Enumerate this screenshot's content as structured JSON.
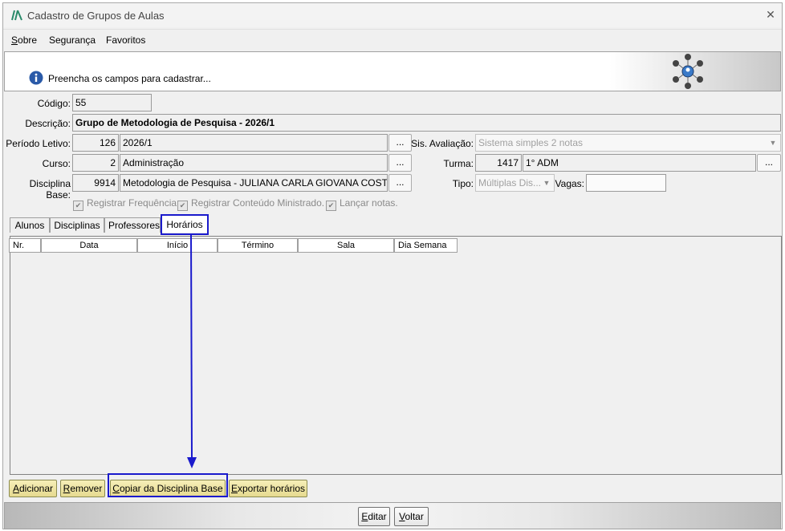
{
  "window": {
    "title": "Cadastro de Grupos de Aulas",
    "close_label": "✕"
  },
  "menu": {
    "items": [
      "Sobre",
      "Segurança",
      "Favoritos"
    ]
  },
  "banner": {
    "message": "Preencha os campos para cadastrar..."
  },
  "form": {
    "codigo": {
      "label": "Código:",
      "value": "55"
    },
    "descricao": {
      "label": "Descrição:",
      "value": "Grupo de Metodologia de Pesquisa - 2026/1"
    },
    "periodo": {
      "label": "Período Letivo:",
      "code": "126",
      "value": "2026/1"
    },
    "curso": {
      "label": "Curso:",
      "code": "2",
      "value": "Administração"
    },
    "disciplina": {
      "label": "Disciplina Base:",
      "code": "9914",
      "value": "Metodologia de Pesquisa - JULIANA CARLA GIOVANA COSTA"
    },
    "sis_avaliacao": {
      "label": "Sis. Avaliação:",
      "value": "Sistema simples 2 notas"
    },
    "turma": {
      "label": "Turma:",
      "code": "1417",
      "value": "1° ADM"
    },
    "tipo": {
      "label": "Tipo:",
      "value": "Múltiplas Dis..."
    },
    "vagas": {
      "label": "Vagas:",
      "value": ""
    },
    "dots_label": "...",
    "checks": [
      "Registrar Frequência.",
      "Registrar Conteúdo Ministrado.",
      "Lançar notas."
    ]
  },
  "tabs": [
    "Alunos",
    "Disciplinas",
    "Professores",
    "Horários"
  ],
  "active_tab": "Horários",
  "grid": {
    "columns": [
      "Nr.",
      "Data",
      "Início",
      "Término",
      "Sala",
      "Dia Semana"
    ],
    "rows": []
  },
  "actions": {
    "add": {
      "underline": "A",
      "rest": "dicionar"
    },
    "remove": {
      "underline": "R",
      "rest": "emover"
    },
    "copy": {
      "underline": "C",
      "rest": "opiar da Disciplina Base"
    },
    "export": {
      "underline": "E",
      "rest": "xportar horários"
    }
  },
  "footer": {
    "edit": {
      "underline": "E",
      "rest": "ditar"
    },
    "back": {
      "underline": "V",
      "rest": "oltar"
    }
  },
  "colors": {
    "annotation": "#1a1acc",
    "action_button": "#efe3a4",
    "info_icon": "#2a5aa8"
  }
}
